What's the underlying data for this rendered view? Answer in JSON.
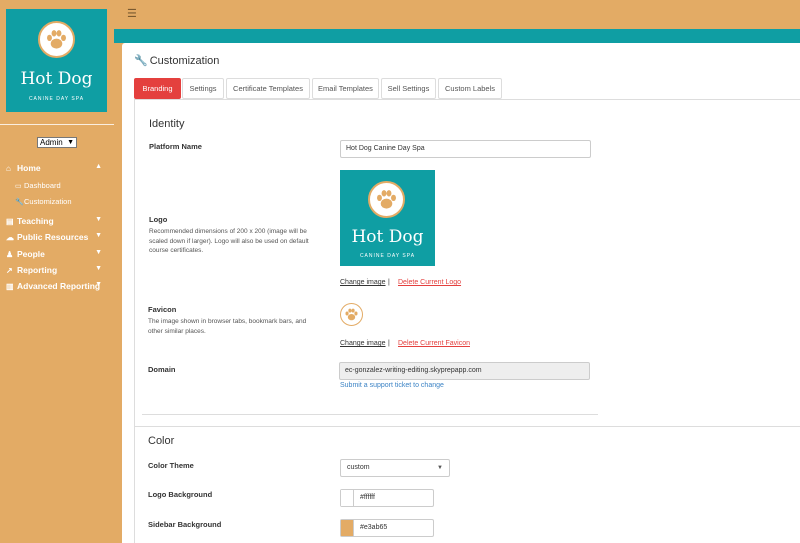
{
  "brand": {
    "name": "Hot Dog",
    "tagline": "CANINE DAY SPA"
  },
  "colors": {
    "teal": "#0f9ea3",
    "sidebar": "#e3ab65",
    "accent_red": "#e4403e",
    "link_blue": "#3b83c5"
  },
  "sidebar": {
    "role": "Admin",
    "nav": [
      {
        "label": "Home",
        "icon": "home-icon"
      },
      {
        "label": "Dashboard",
        "icon": "monitor-icon"
      },
      {
        "label": "Customization",
        "icon": "wrench-icon"
      },
      {
        "label": "Teaching",
        "icon": "book-icon"
      },
      {
        "label": "Public Resources",
        "icon": "cloud-icon"
      },
      {
        "label": "People",
        "icon": "person-icon"
      },
      {
        "label": "Reporting",
        "icon": "line-chart-icon"
      },
      {
        "label": "Advanced Reporting",
        "icon": "bar-chart-icon"
      }
    ]
  },
  "page": {
    "title": "Customization",
    "tabs": [
      "Branding",
      "Settings",
      "Certificate Templates",
      "Email Templates",
      "Sell Settings",
      "Custom Labels"
    ],
    "active_tab": "Branding"
  },
  "identity": {
    "heading": "Identity",
    "platform_name_label": "Platform Name",
    "platform_name_value": "Hot Dog Canine Day Spa",
    "logo_label": "Logo",
    "logo_help": "Recommended dimensions of 200 x 200 (image will be scaled down if larger). Logo will also be used on default course certificates.",
    "change_image": "Change image",
    "delete_logo": "Delete Current Logo",
    "separator": "|",
    "favicon_label": "Favicon",
    "favicon_help": "The image shown in browser tabs, bookmark bars, and other similar places.",
    "delete_favicon": "Delete Current Favicon",
    "domain_label": "Domain",
    "domain_value": "ec-gonzalez-writing-editing.skyprepapp.com",
    "domain_link": "Submit a support ticket to change"
  },
  "color": {
    "heading": "Color",
    "theme_label": "Color Theme",
    "theme_value": "custom",
    "logo_bg_label": "Logo Background",
    "logo_bg_value": "#ffffff",
    "sidebar_bg_label": "Sidebar Background",
    "sidebar_bg_value": "#e3ab65"
  }
}
